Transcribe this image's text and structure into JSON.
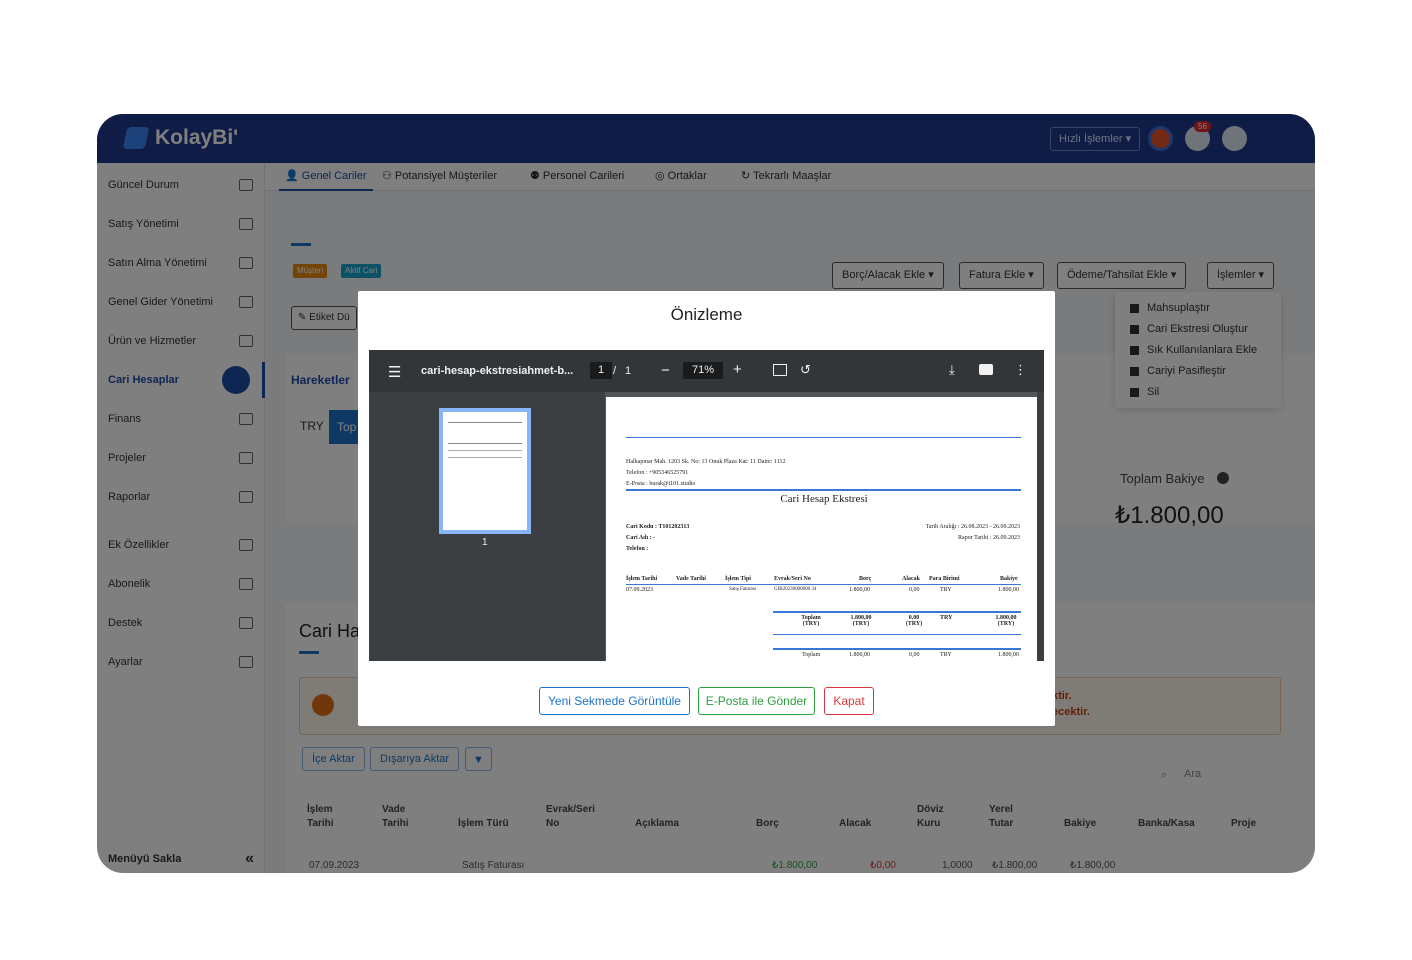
{
  "app": {
    "logo_text": "KolayBi'",
    "quick_actions_label": "Hızlı İşlemler ▾",
    "notification_count": "56"
  },
  "sidebar": {
    "items": [
      {
        "label": "Güncel Durum"
      },
      {
        "label": "Satış Yönetimi"
      },
      {
        "label": "Satın Alma Yönetimi"
      },
      {
        "label": "Genel Gider Yönetimi"
      },
      {
        "label": "Ürün ve Hizmetler"
      },
      {
        "label": "Cari Hesaplar"
      },
      {
        "label": "Finans"
      },
      {
        "label": "Projeler"
      },
      {
        "label": "Raporlar"
      },
      {
        "label": "Ek Özellikler"
      },
      {
        "label": "Abonelik"
      },
      {
        "label": "Destek"
      },
      {
        "label": "Ayarlar"
      }
    ],
    "footer_label": "Menüyü Sakla",
    "footer_icon": "«"
  },
  "tabs": [
    "Genel Cariler",
    "Potansiyel Müşteriler",
    "Personel Carileri",
    "Ortaklar",
    "Tekrarlı Maaşlar"
  ],
  "actions": {
    "borc_alacak": "Borç/Alacak Ekle ▾",
    "fatura": "Fatura Ekle ▾",
    "odeme": "Ödeme/Tahsilat Ekle ▾",
    "islemler": "İşlemler ▾"
  },
  "chips": {
    "musteri": "Müşteri",
    "aktif": "Aktif Cari"
  },
  "etiket_label": "✎ Etiket Dü",
  "dropdown": [
    "Mahsuplaştır",
    "Cari Ekstresi Oluştur",
    "Sık Kullanılanlara Ekle",
    "Cariyi Pasifleştir",
    "Sil"
  ],
  "hareketler": "Hareketler",
  "currency": {
    "try": "TRY",
    "top": "Top"
  },
  "balance": {
    "label": "Toplam Bakiye",
    "value": "₺1.800,00"
  },
  "section_title": "Cari Ha",
  "alert": {
    "line1": "ktir.",
    "line2": "ecektir."
  },
  "table_tools": {
    "ice_aktar": "İçe Aktar",
    "disari_aktar": "Dışarıya Aktar",
    "search_placeholder": "Ara"
  },
  "table": {
    "headers": [
      "İşlem\nTarihi",
      "Vade\nTarihi",
      "İşlem Türü",
      "Evrak/Seri\nNo",
      "Açıklama",
      "Borç",
      "Alacak",
      "Döviz\nKuru",
      "Yerel\nTutar",
      "Bakiye",
      "Banka/Kasa",
      "Proje"
    ],
    "row": [
      "07.09.2023",
      "Satış Faturası",
      "₺1.800,00",
      "₺0,00",
      "1,0000",
      "₺1.800,00",
      "₺1.800,00"
    ]
  },
  "modal": {
    "title": "Önizleme",
    "viewer": {
      "filename": "cari-hesap-ekstresiahmet-b...",
      "page": "1",
      "page_sep": "/",
      "total_pages": "1",
      "zoom": "71%",
      "thumb_label": "1"
    },
    "doc": {
      "address": "Halkapınar Mah. 1203 Sk. No: 13 Onuk Plaza Kat: 11 Daire: 1112",
      "phone": "Telefon : +905346525791",
      "email": "E-Posta : burak@t101.studio",
      "title": "Cari Hesap Ekstresi",
      "cari_kodu": "Cari Kodu : T101202313",
      "cari_adi": "Cari Adı : ‑",
      "telefon": "Telefon :",
      "tarih_araligi": "Tarih Aralığı : 26.08.2023 - 26.09.2023",
      "rapor_tarihi": "Rapor Tarihi : 26.09.2023",
      "headers": [
        "İşlem Tarihi",
        "Vade Tarihi",
        "İşlem Tipi",
        "Evrak/Seri No",
        "Borç",
        "Alacak",
        "Para Birimi",
        "Bakiye"
      ],
      "row": [
        "07.09.2023",
        "Satış Faturası",
        "GIB20230000000 34",
        "1.800,00",
        "0,00",
        "TRY",
        "1.800,00"
      ],
      "total": {
        "label": "Toplam (TRY)",
        "borc": "1.800,00 (TRY)",
        "alacak": "0,00 (TRY)",
        "currency": "TRY",
        "bakiye": "1.800,00 (TRY)"
      },
      "total2": {
        "label": "Toplam",
        "borc": "1.800,00",
        "alacak": "0,00",
        "currency": "TRY",
        "bakiye": "1.800,00"
      }
    },
    "buttons": {
      "new_tab": "Yeni Sekmede Görüntüle",
      "email": "E-Posta ile Gönder",
      "close": "Kapat"
    }
  },
  "colors": {
    "primary": "#1e3a8c",
    "accent": "#1a73c8",
    "success": "#2e9e3e",
    "danger": "#d9373f",
    "warning": "#e8880f"
  }
}
